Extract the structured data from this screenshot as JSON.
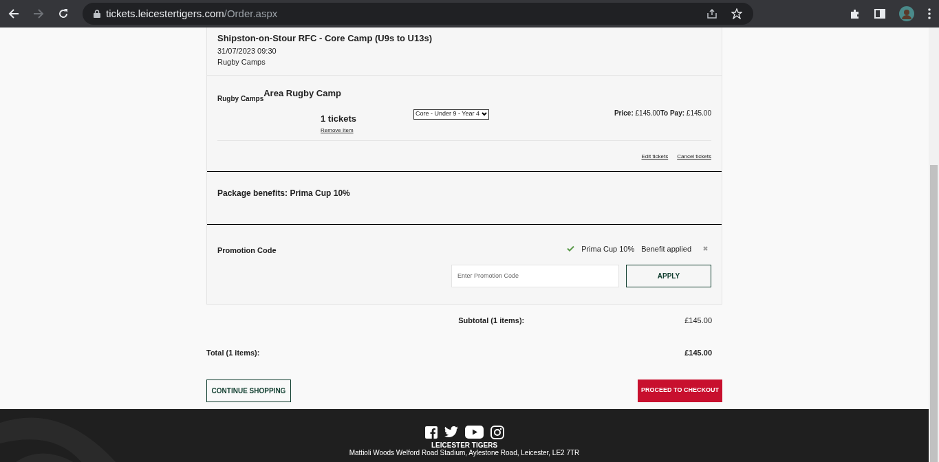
{
  "browser": {
    "url_host": "tickets.leicestertigers.com",
    "url_path": "/Order.aspx",
    "back_enabled": true,
    "forward_enabled": false
  },
  "event": {
    "title": "Shipston-on-Stour RFC - Core Camp (U9s to U13s)",
    "datetime": "31/07/2023 09:30",
    "category": "Rugby Camps"
  },
  "item": {
    "category": "Rugby Camps",
    "name": "Area Rugby Camp",
    "quantity": "1 tickets",
    "remove_link": "Remove Item",
    "ticket_type": "Core - Under 9 - Year 4",
    "price_label": "Price:",
    "price": "£145.00",
    "to_pay_label": "To Pay:",
    "to_pay": "£145.00",
    "edit_link": "Edit tickets",
    "cancel_link": "Cancel tickets"
  },
  "package_benefits": "Package benefits: Prima Cup 10%",
  "promotion": {
    "label": "Promotion Code",
    "applied_code": "Prima Cup 10%",
    "applied_status": "Benefit applied",
    "input_placeholder": "Enter Promotion Code",
    "apply_button": "APPLY"
  },
  "subtotal": {
    "label": "Subtotal (1 items):",
    "value": "£145.00"
  },
  "total": {
    "label": "Total (1 items):",
    "value": "£145.00"
  },
  "buttons": {
    "continue": "CONTINUE SHOPPING",
    "checkout": "PROCEED TO CHECKOUT"
  },
  "footer": {
    "org": "LEICESTER TIGERS",
    "address": "Mattioli Woods Welford Road Stadium, Aylestone Road, Leicester, LE2 7TR"
  }
}
